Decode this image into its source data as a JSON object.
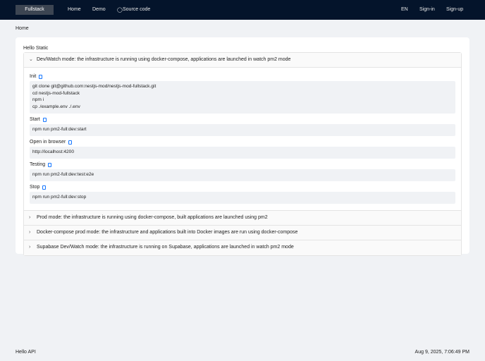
{
  "nav": {
    "brand": "Fullstack",
    "home": "Home",
    "demo": "Demo",
    "source": "Source code",
    "lang": "EN",
    "signin": "Sign-in",
    "signup": "Sign-up"
  },
  "breadcrumb": "Home",
  "card_title": "Hello Static",
  "panels": [
    {
      "title": "Dev/Watch mode: the infrastructure is running using docker-compose, applications are launched in watch pm2 mode",
      "expanded": true
    },
    {
      "title": "Prod mode: the infrastructure is running using docker-compose, built applications are launched using pm2"
    },
    {
      "title": "Docker-compose prod mode: the infrastructure and applications built into Docker images are run using docker-compose"
    },
    {
      "title": "Supabase Dev/Watch mode: the infrastructure is running on Supabase, applications are launched in watch pm2 mode"
    }
  ],
  "steps": [
    {
      "label": "Init",
      "value": "git clone git@github.com:nestjs-mod/nestjs-mod-fullstack.git\ncd nestjs-mod-fullstack\nnpm i\ncp ./example.env ./.env"
    },
    {
      "label": "Start",
      "value": "npm run pm2-full:dev:start"
    },
    {
      "label": "Open in browser",
      "value": "http://localhost:4200"
    },
    {
      "label": "Testing",
      "value": "npm run pm2-full:dev:test:e2e"
    },
    {
      "label": "Stop",
      "value": "npm run pm2-full:dev:stop"
    }
  ],
  "footer": {
    "left": "Hello API",
    "right": "Aug 9, 2025, 7:06:49 PM"
  }
}
